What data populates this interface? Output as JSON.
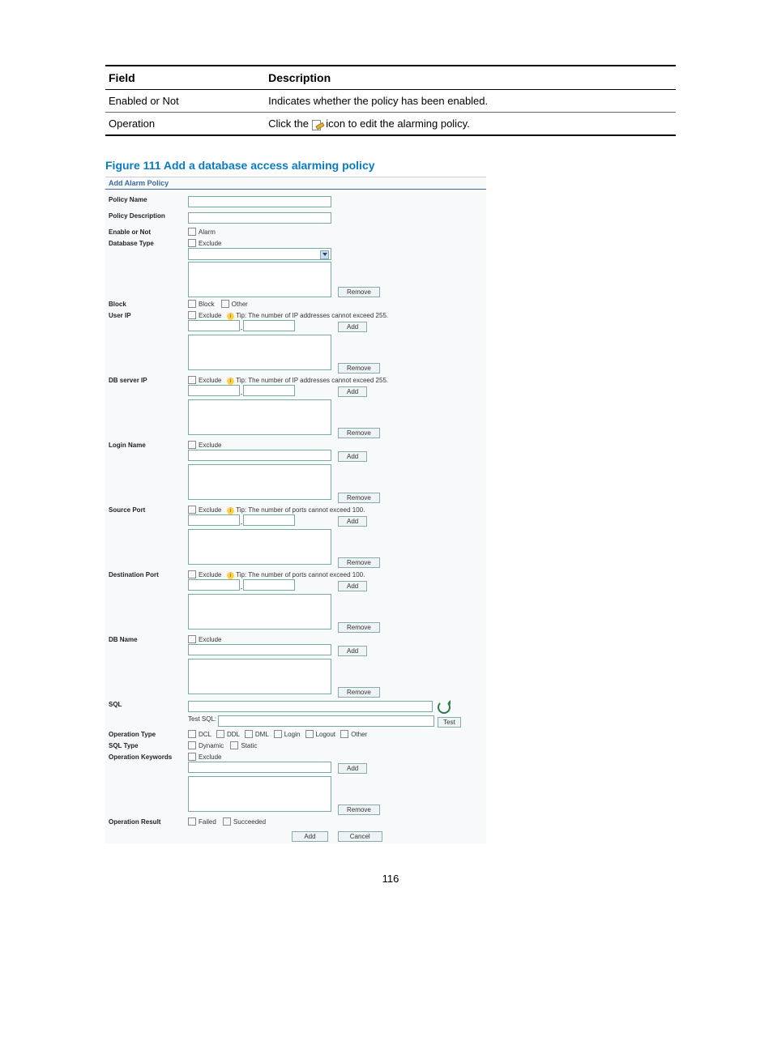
{
  "table": {
    "headers": [
      "Field",
      "Description"
    ],
    "rows": [
      {
        "field": "Enabled or Not",
        "desc": "Indicates whether the policy has been enabled."
      },
      {
        "field": "Operation",
        "desc_before": "Click the ",
        "desc_after": " icon to edit the alarming policy."
      }
    ]
  },
  "figure_caption": "Figure 111 Add a database access alarming policy",
  "form": {
    "title": "Add Alarm Policy",
    "labels": {
      "policy_name": "Policy Name",
      "policy_desc": "Policy Description",
      "enable": "Enable or Not",
      "db_type": "Database Type",
      "block": "Block",
      "user_ip": "User IP",
      "db_server_ip": "DB server IP",
      "login_name": "Login Name",
      "source_port": "Source Port",
      "dest_port": "Destination Port",
      "db_name": "DB Name",
      "sql": "SQL",
      "test_sql": "Test SQL:",
      "op_type": "Operation Type",
      "sql_type": "SQL Type",
      "op_kw": "Operation Keywords",
      "op_result": "Operation Result"
    },
    "chk": {
      "alarm": "Alarm",
      "exclude": "Exclude",
      "block": "Block",
      "other": "Other",
      "dcl": "DCL",
      "ddl": "DDL",
      "dml": "DML",
      "login": "Login",
      "logout": "Logout",
      "dynamic": "Dynamic",
      "static": "Static",
      "failed": "Failed",
      "succeeded": "Succeeded"
    },
    "tips": {
      "ip255": "Tip: The number of IP addresses cannot exceed 255.",
      "port100": "Tip: The number of ports cannot exceed 100."
    },
    "buttons": {
      "add": "Add",
      "remove": "Remove",
      "test": "Test",
      "cancel": "Cancel"
    }
  },
  "page_number": "116"
}
